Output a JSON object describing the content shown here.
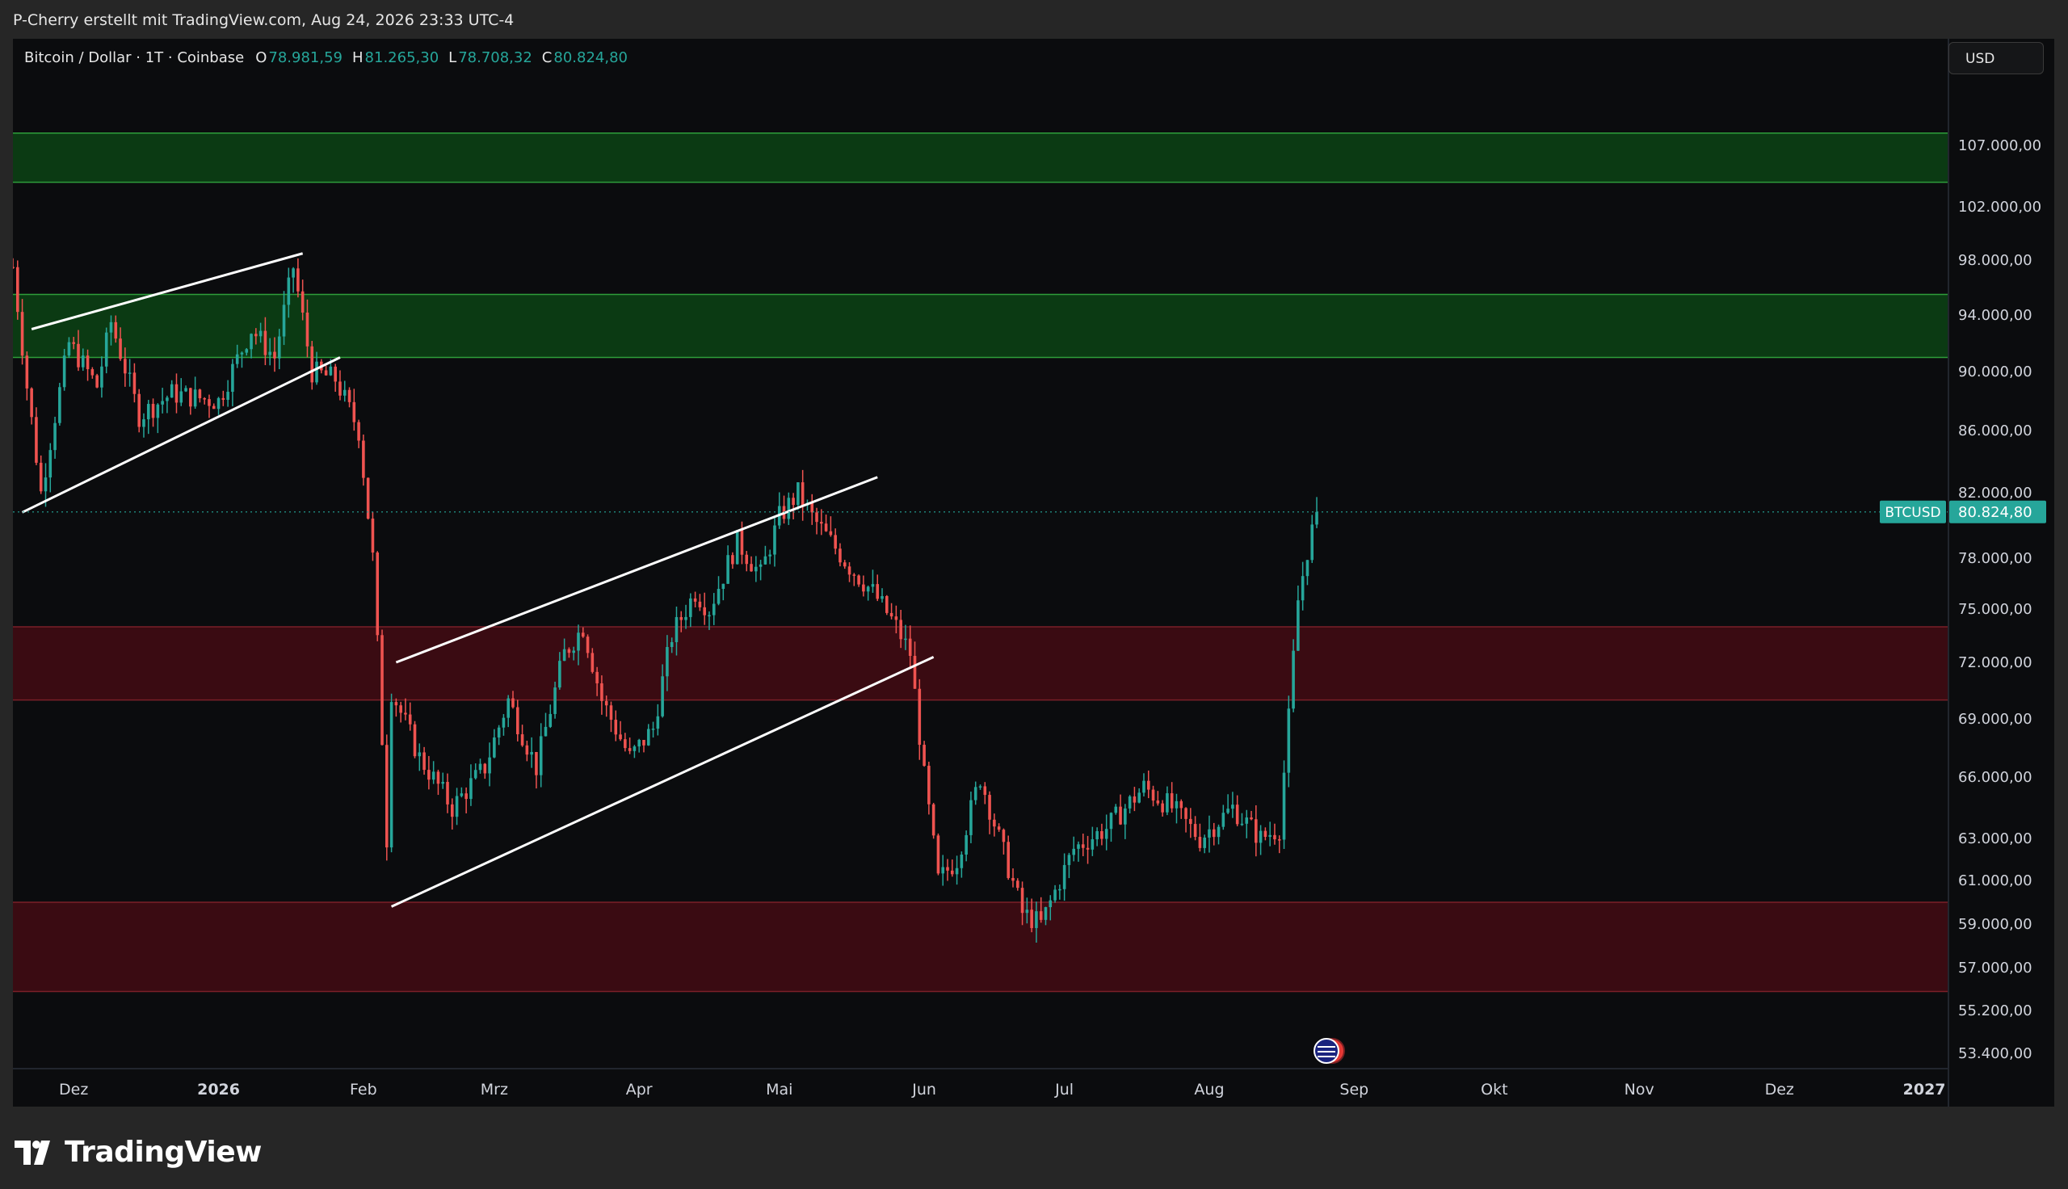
{
  "header": {
    "credit": "P-Cherry erstellt mit TradingView.com, Aug 24, 2026 23:33 UTC-4"
  },
  "legend": {
    "symbol": "Bitcoin / Dollar · 1T · Coinbase",
    "o_label": "O",
    "o_value": "78.981,59",
    "h_label": "H",
    "h_value": "81.265,30",
    "l_label": "L",
    "l_value": "78.708,32",
    "c_label": "C",
    "c_value": "80.824,80"
  },
  "currency": "USD",
  "price_badge": {
    "ticker": "BTCUSD",
    "price": "80.824,80"
  },
  "brand": "TradingView",
  "colors": {
    "up": "#26a69a",
    "down": "#ef5350",
    "zone_green": "#0b3a13",
    "zone_red": "#3a0b12",
    "accent": "#26a69a"
  },
  "chart_data": {
    "type": "candlestick",
    "y_axis_ticks": [
      {
        "value": 107000,
        "label": "107.000,00"
      },
      {
        "value": 102000,
        "label": "102.000,00"
      },
      {
        "value": 98000,
        "label": "98.000,00"
      },
      {
        "value": 94000,
        "label": "94.000,00"
      },
      {
        "value": 90000,
        "label": "90.000,00"
      },
      {
        "value": 86000,
        "label": "86.000,00"
      },
      {
        "value": 82000,
        "label": "82.000,00"
      },
      {
        "value": 78000,
        "label": "78.000,00"
      },
      {
        "value": 75000,
        "label": "75.000,00"
      },
      {
        "value": 72000,
        "label": "72.000,00"
      },
      {
        "value": 69000,
        "label": "69.000,00"
      },
      {
        "value": 66000,
        "label": "66.000,00"
      },
      {
        "value": 63000,
        "label": "63.000,00"
      },
      {
        "value": 61000,
        "label": "61.000,00"
      },
      {
        "value": 59000,
        "label": "59.000,00"
      },
      {
        "value": 57000,
        "label": "57.000,00"
      },
      {
        "value": 55200,
        "label": "55.200,00"
      },
      {
        "value": 53400,
        "label": "53.400,00"
      }
    ],
    "x_axis_ticks": [
      {
        "date": "2025-12-01",
        "label": "Dez",
        "bold": false
      },
      {
        "date": "2026-01-01",
        "label": "2026",
        "bold": true
      },
      {
        "date": "2026-02-01",
        "label": "Feb",
        "bold": false
      },
      {
        "date": "2026-03-01",
        "label": "Mrz",
        "bold": false
      },
      {
        "date": "2026-04-01",
        "label": "Apr",
        "bold": false
      },
      {
        "date": "2026-05-01",
        "label": "Mai",
        "bold": false
      },
      {
        "date": "2026-06-01",
        "label": "Jun",
        "bold": false
      },
      {
        "date": "2026-07-01",
        "label": "Jul",
        "bold": false
      },
      {
        "date": "2026-08-01",
        "label": "Aug",
        "bold": false
      },
      {
        "date": "2026-09-01",
        "label": "Sep",
        "bold": false
      },
      {
        "date": "2026-10-01",
        "label": "Okt",
        "bold": false
      },
      {
        "date": "2026-11-01",
        "label": "Nov",
        "bold": false
      },
      {
        "date": "2026-12-01",
        "label": "Dez",
        "bold": false
      },
      {
        "date": "2027-01-01",
        "label": "2027",
        "bold": true
      }
    ],
    "x_range": [
      "2025-11-18",
      "2027-01-06"
    ],
    "last_price": 80824.8,
    "zones": [
      {
        "color": "green",
        "top": 108000,
        "bottom": 104000
      },
      {
        "color": "green",
        "top": 95500,
        "bottom": 91000
      },
      {
        "color": "red",
        "top": 74000,
        "bottom": 70000
      },
      {
        "color": "red",
        "top": 60000,
        "bottom": 56000
      }
    ],
    "trendlines": [
      {
        "from": [
          "2025-11-22",
          93000
        ],
        "to": [
          "2026-01-19",
          98500
        ]
      },
      {
        "from": [
          "2025-11-20",
          80800
        ],
        "to": [
          "2026-01-27",
          91000
        ]
      },
      {
        "from": [
          "2026-02-08",
          72000
        ],
        "to": [
          "2026-05-22",
          83000
        ]
      },
      {
        "from": [
          "2026-02-07",
          59800
        ],
        "to": [
          "2026-06-03",
          72300
        ]
      }
    ],
    "keypoints": [
      [
        "2025-11-18",
        97500
      ],
      [
        "2025-11-21",
        89000
      ],
      [
        "2025-11-24",
        82000
      ],
      [
        "2025-11-30",
        92000
      ],
      [
        "2025-12-06",
        89000
      ],
      [
        "2025-12-09",
        93500
      ],
      [
        "2025-12-15",
        87000
      ],
      [
        "2025-12-22",
        88500
      ],
      [
        "2026-01-01",
        88000
      ],
      [
        "2026-01-08",
        93000
      ],
      [
        "2026-01-13",
        91000
      ],
      [
        "2026-01-17",
        97500
      ],
      [
        "2026-01-21",
        90000
      ],
      [
        "2026-01-26",
        89500
      ],
      [
        "2026-01-31",
        86000
      ],
      [
        "2026-02-03",
        78000
      ],
      [
        "2026-02-06",
        63000
      ],
      [
        "2026-02-07",
        70500
      ],
      [
        "2026-02-13",
        67000
      ],
      [
        "2026-02-20",
        64500
      ],
      [
        "2026-02-27",
        66500
      ],
      [
        "2026-03-04",
        70000
      ],
      [
        "2026-03-10",
        66500
      ],
      [
        "2026-03-16",
        72500
      ],
      [
        "2026-03-20",
        74000
      ],
      [
        "2026-03-24",
        70000
      ],
      [
        "2026-03-30",
        67000
      ],
      [
        "2026-04-04",
        68500
      ],
      [
        "2026-04-08",
        73500
      ],
      [
        "2026-04-13",
        76000
      ],
      [
        "2026-04-16",
        75000
      ],
      [
        "2026-04-22",
        79000
      ],
      [
        "2026-04-27",
        77000
      ],
      [
        "2026-05-01",
        80500
      ],
      [
        "2026-05-05",
        82000
      ],
      [
        "2026-05-08",
        80500
      ],
      [
        "2026-05-12",
        79000
      ],
      [
        "2026-05-16",
        77500
      ],
      [
        "2026-05-21",
        76000
      ],
      [
        "2026-05-26",
        74000
      ],
      [
        "2026-05-29",
        72500
      ],
      [
        "2026-06-01",
        66000
      ],
      [
        "2026-06-04",
        61000
      ],
      [
        "2026-06-08",
        62000
      ],
      [
        "2026-06-13",
        66000
      ],
      [
        "2026-06-17",
        63000
      ],
      [
        "2026-06-22",
        59500
      ],
      [
        "2026-06-26",
        59000
      ],
      [
        "2026-07-03",
        62500
      ],
      [
        "2026-07-10",
        63500
      ],
      [
        "2026-07-18",
        65500
      ],
      [
        "2026-07-24",
        64500
      ],
      [
        "2026-07-30",
        63000
      ],
      [
        "2026-08-06",
        64500
      ],
      [
        "2026-08-12",
        63000
      ],
      [
        "2026-08-16",
        63500
      ],
      [
        "2026-08-18",
        69000
      ],
      [
        "2026-08-20",
        75500
      ],
      [
        "2026-08-22",
        78500
      ],
      [
        "2026-08-24",
        80825
      ]
    ]
  }
}
